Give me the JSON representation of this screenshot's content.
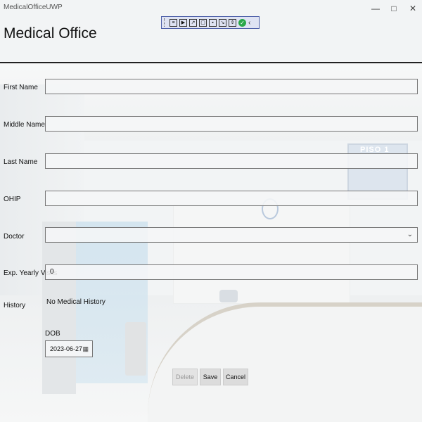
{
  "window": {
    "title": "MedicalOfficeUWP",
    "minimize_icon": "minimize-icon",
    "maximize_icon": "maximize-icon",
    "close_icon": "close-icon"
  },
  "header": {
    "title": "Medical Office"
  },
  "form": {
    "first_name_label": "First Name",
    "first_name_value": "",
    "middle_name_label": "Middle Name",
    "middle_name_value": "",
    "last_name_label": "Last Name",
    "last_name_value": "",
    "ohip_label": "OHIP",
    "ohip_value": "",
    "doctor_label": "Doctor",
    "doctor_value": "",
    "visits_label": "Exp. Yearly Visits",
    "visits_value": "0",
    "history_label": "History",
    "history_value": "No Medical History",
    "dob_label": "DOB",
    "dob_value": "2023-06-27"
  },
  "actions": {
    "delete_label": "Delete",
    "save_label": "Save",
    "cancel_label": "Cancel"
  },
  "background": {
    "sign_text": "PISO 1"
  },
  "colors": {
    "accent_border": "#4d5fa8",
    "check_green": "#2aa84a"
  }
}
